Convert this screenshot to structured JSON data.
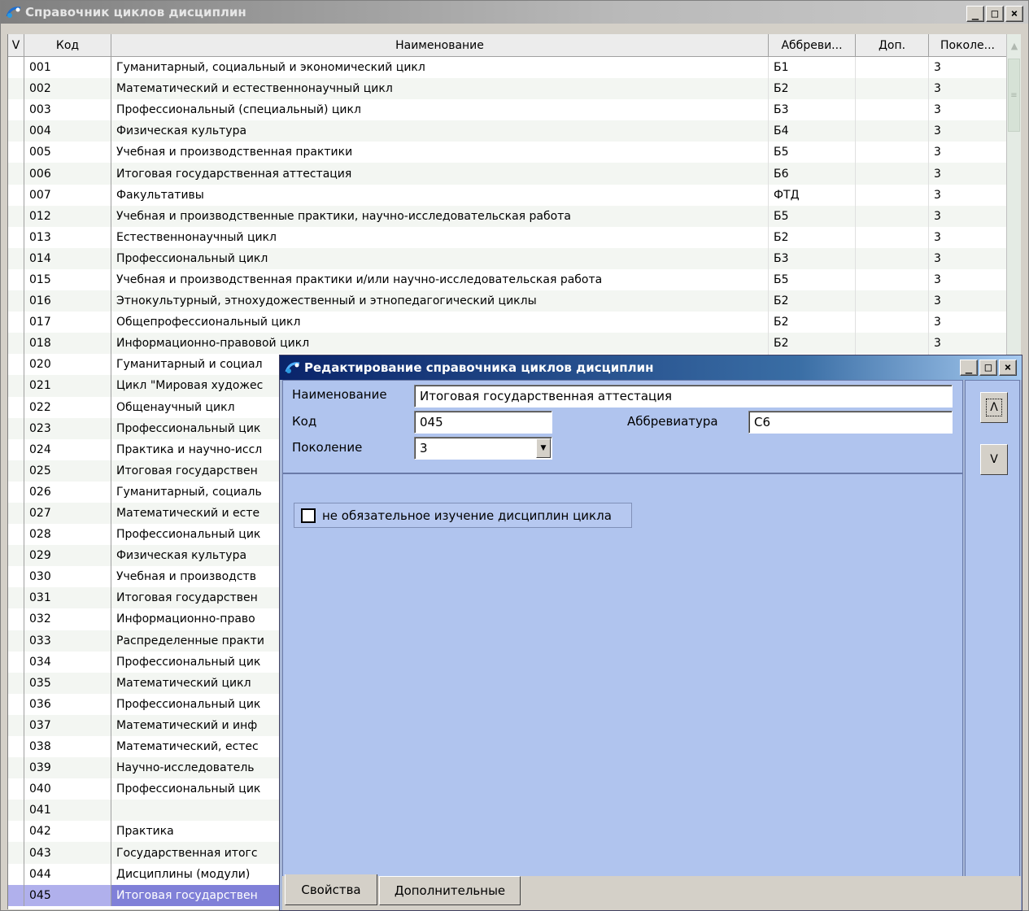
{
  "main_window": {
    "title": "Справочник циклов дисциплин",
    "controls": {
      "minimize": "_",
      "maximize": "□",
      "close": "×"
    }
  },
  "table": {
    "columns": [
      "V",
      "Код",
      "Наименование",
      "Аббреви...",
      "Доп.",
      "Поколе..."
    ],
    "rows": [
      {
        "code": "001",
        "name": "Гуманитарный, социальный и экономический цикл",
        "abbr": "Б1",
        "dop": "",
        "gen": "3"
      },
      {
        "code": "002",
        "name": "Математический и естественнонаучный цикл",
        "abbr": "Б2",
        "dop": "",
        "gen": "3"
      },
      {
        "code": "003",
        "name": "Профессиональный (специальный)  цикл",
        "abbr": "Б3",
        "dop": "",
        "gen": "3"
      },
      {
        "code": "004",
        "name": "Физическая культура",
        "abbr": "Б4",
        "dop": "",
        "gen": "3"
      },
      {
        "code": "005",
        "name": "Учебная и производственная практики",
        "abbr": "Б5",
        "dop": "",
        "gen": "3"
      },
      {
        "code": "006",
        "name": "Итоговая государственная аттестация",
        "abbr": "Б6",
        "dop": "",
        "gen": "3"
      },
      {
        "code": "007",
        "name": "Факультативы",
        "abbr": "ФТД",
        "dop": "",
        "gen": "3"
      },
      {
        "code": "012",
        "name": "Учебная и производственные практики, научно-исследовательская работа",
        "abbr": "Б5",
        "dop": "",
        "gen": "3"
      },
      {
        "code": "013",
        "name": "Естественнонаучный цикл",
        "abbr": "Б2",
        "dop": "",
        "gen": "3"
      },
      {
        "code": "014",
        "name": "Профессиональный цикл",
        "abbr": "Б3",
        "dop": "",
        "gen": "3"
      },
      {
        "code": "015",
        "name": "Учебная и производственная практики и/или научно-исследовательская работа",
        "abbr": "Б5",
        "dop": "",
        "gen": "3"
      },
      {
        "code": "016",
        "name": "Этнокультурный, этнохудожественный и этнопедагогический циклы",
        "abbr": "Б2",
        "dop": "",
        "gen": "3"
      },
      {
        "code": "017",
        "name": "Общепрофессиональный цикл",
        "abbr": "Б2",
        "dop": "",
        "gen": "3"
      },
      {
        "code": "018",
        "name": "Информационно-правовой цикл",
        "abbr": "Б2",
        "dop": "",
        "gen": "3"
      },
      {
        "code": "020",
        "name": "Гуманитарный и социал",
        "abbr": "",
        "dop": "",
        "gen": ""
      },
      {
        "code": "021",
        "name": "Цикл \"Мировая художес",
        "abbr": "",
        "dop": "",
        "gen": ""
      },
      {
        "code": "022",
        "name": "Общенаучный цикл",
        "abbr": "",
        "dop": "",
        "gen": ""
      },
      {
        "code": "023",
        "name": "Профессиональный цик",
        "abbr": "",
        "dop": "",
        "gen": ""
      },
      {
        "code": "024",
        "name": "Практика и научно-иссл",
        "abbr": "",
        "dop": "",
        "gen": ""
      },
      {
        "code": "025",
        "name": "Итоговая государствен",
        "abbr": "",
        "dop": "",
        "gen": ""
      },
      {
        "code": "026",
        "name": "Гуманитарный, социаль",
        "abbr": "",
        "dop": "",
        "gen": ""
      },
      {
        "code": "027",
        "name": "Математический и есте",
        "abbr": "",
        "dop": "",
        "gen": ""
      },
      {
        "code": "028",
        "name": "Профессиональный цик",
        "abbr": "",
        "dop": "",
        "gen": ""
      },
      {
        "code": "029",
        "name": "Физическая культура",
        "abbr": "",
        "dop": "",
        "gen": ""
      },
      {
        "code": "030",
        "name": "Учебная и производств",
        "abbr": "",
        "dop": "",
        "gen": ""
      },
      {
        "code": "031",
        "name": "Итоговая государствен",
        "abbr": "",
        "dop": "",
        "gen": ""
      },
      {
        "code": "032",
        "name": "Информационно-право",
        "abbr": "",
        "dop": "",
        "gen": ""
      },
      {
        "code": "033",
        "name": "Распределенные практи",
        "abbr": "",
        "dop": "",
        "gen": ""
      },
      {
        "code": "034",
        "name": "Профессиональный цик",
        "abbr": "",
        "dop": "",
        "gen": ""
      },
      {
        "code": "035",
        "name": "Математический цикл",
        "abbr": "",
        "dop": "",
        "gen": ""
      },
      {
        "code": "036",
        "name": "Профессиональный цик",
        "abbr": "",
        "dop": "",
        "gen": ""
      },
      {
        "code": "037",
        "name": "Математический и инф",
        "abbr": "",
        "dop": "",
        "gen": ""
      },
      {
        "code": "038",
        "name": "Математический, естес",
        "abbr": "",
        "dop": "",
        "gen": ""
      },
      {
        "code": "039",
        "name": "Научно-исследователь",
        "abbr": "",
        "dop": "",
        "gen": ""
      },
      {
        "code": "040",
        "name": "Профессиональный цик",
        "abbr": "",
        "dop": "",
        "gen": ""
      },
      {
        "code": "041",
        "name": "",
        "abbr": "",
        "dop": "",
        "gen": ""
      },
      {
        "code": "042",
        "name": "Практика",
        "abbr": "",
        "dop": "",
        "gen": ""
      },
      {
        "code": "043",
        "name": "Государственная итогс",
        "abbr": "",
        "dop": "",
        "gen": ""
      },
      {
        "code": "044",
        "name": "Дисциплины (модули)",
        "abbr": "",
        "dop": "",
        "gen": ""
      },
      {
        "code": "045",
        "name": "Итоговая государствен",
        "abbr": "",
        "dop": "",
        "gen": "",
        "selected": true
      }
    ]
  },
  "dialog": {
    "title": "Редактирование справочника циклов дисциплин",
    "controls": {
      "minimize": "_",
      "maximize": "□",
      "close": "×"
    },
    "fields": {
      "name_label": "Наименование",
      "name_value": "Итоговая государственная аттестация",
      "code_label": "Код",
      "code_value": "045",
      "abbr_label": "Аббревиатура",
      "abbr_value": "С6",
      "generation_label": "Поколение",
      "generation_value": "3"
    },
    "checkbox": {
      "label": "не обязательное изучение дисциплин цикла",
      "checked": false
    },
    "side_buttons": {
      "up": "Λ",
      "down": "V"
    },
    "tabs": [
      "Свойства",
      "Дополнительные"
    ],
    "active_tab": "Свойства"
  },
  "colors": {
    "dialog_title_start": "#0a246a",
    "dialog_title_end": "#a6caf0",
    "dialog_body": "#b0c4ee",
    "selected_row": "#b0b0ec",
    "selected_cell": "#8080d8"
  }
}
